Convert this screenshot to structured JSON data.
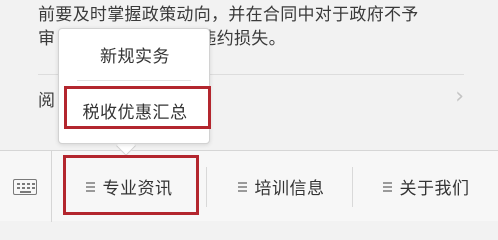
{
  "article": {
    "line1": "前要及时掌握政策动向，并在合同中对于政府不予",
    "line2": "审                          免遭受履约不能的违约损失。",
    "read_label": "阅"
  },
  "menu": {
    "items": [
      {
        "label": "专业资讯",
        "icon": "hamburger-icon"
      },
      {
        "label": "培训信息",
        "icon": "hamburger-icon"
      },
      {
        "label": "关于我们",
        "icon": "hamburger-icon"
      }
    ],
    "keyboard_icon": "keyboard-icon"
  },
  "submenu": {
    "items": [
      {
        "label": "新规实务"
      },
      {
        "label": "税收优惠汇总"
      }
    ]
  },
  "colors": {
    "highlight": "#b3262e",
    "background": "#f2f2f2",
    "menu_bar": "#f7f7f7"
  }
}
